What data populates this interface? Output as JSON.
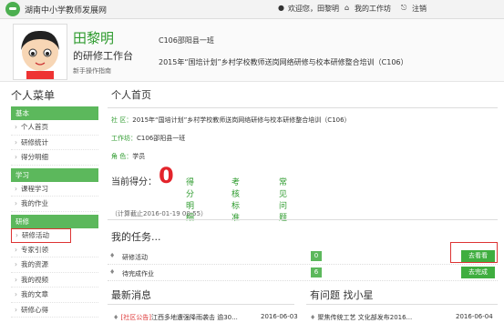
{
  "topbar": {
    "site_name": "湖南中小学教师发展网",
    "welcome": "欢迎您，田黎明",
    "my_studio": "我的工作坊",
    "logout": "注销"
  },
  "profile": {
    "name": "田黎明",
    "workbench": "的研修工作台",
    "guide": "新手操作指南",
    "class_name": "C106邵阳县一班",
    "project": "2015年“国培计划”乡村学校教师送岗网络研修与校本研修整合培训（C106）"
  },
  "sidebar": {
    "title": "个人菜单",
    "sections": [
      {
        "label": "基本",
        "items": [
          "个人首页",
          "研修统计",
          "得分明细"
        ]
      },
      {
        "label": "学习",
        "items": [
          "课程学习",
          "我的作业"
        ]
      },
      {
        "label": "研修",
        "items": [
          "研修活动",
          "专家引领",
          "我的资源",
          "我的视频",
          "我的文章",
          "研修心得"
        ]
      }
    ]
  },
  "main": {
    "title": "个人首页",
    "community_label": "社 区：",
    "community_value": "2015年“国培计划”乡村学校教师送岗网络研修与校本研修整合培训（C106）",
    "studio_label": "工作坊：",
    "studio_value": "C106邵阳县一班",
    "role_label": "角 色：",
    "role_value": "学员",
    "score_label": "当前得分：",
    "score_value": "0",
    "links": [
      "得分明细",
      "考核标准",
      "常见问题"
    ],
    "calc_note": "（计算截止2016-01-19 00:55）",
    "tasks_title": "我的任务...",
    "tasks": [
      {
        "label": "研修活动",
        "count": "0",
        "button": "去看看"
      },
      {
        "label": "待完成作业",
        "count": "6",
        "button": "去完成"
      }
    ],
    "news_title": "最新消息",
    "news_item": "[社区公告]江西多地遭强降雨袭击 逾30...",
    "news_tag": "[社区公告]",
    "news_text": "江西多地遭强降雨袭击 逾30...",
    "news_date": "2016-06-03",
    "qa_title": "有问题 找小星",
    "qa_item": "聚焦传统工艺 文化部发布2016...",
    "qa_date": "2016-06-04"
  },
  "colors": {
    "accent_green": "#5cb85c",
    "score_red": "#e3242b",
    "highlight_red": "#d33333"
  }
}
